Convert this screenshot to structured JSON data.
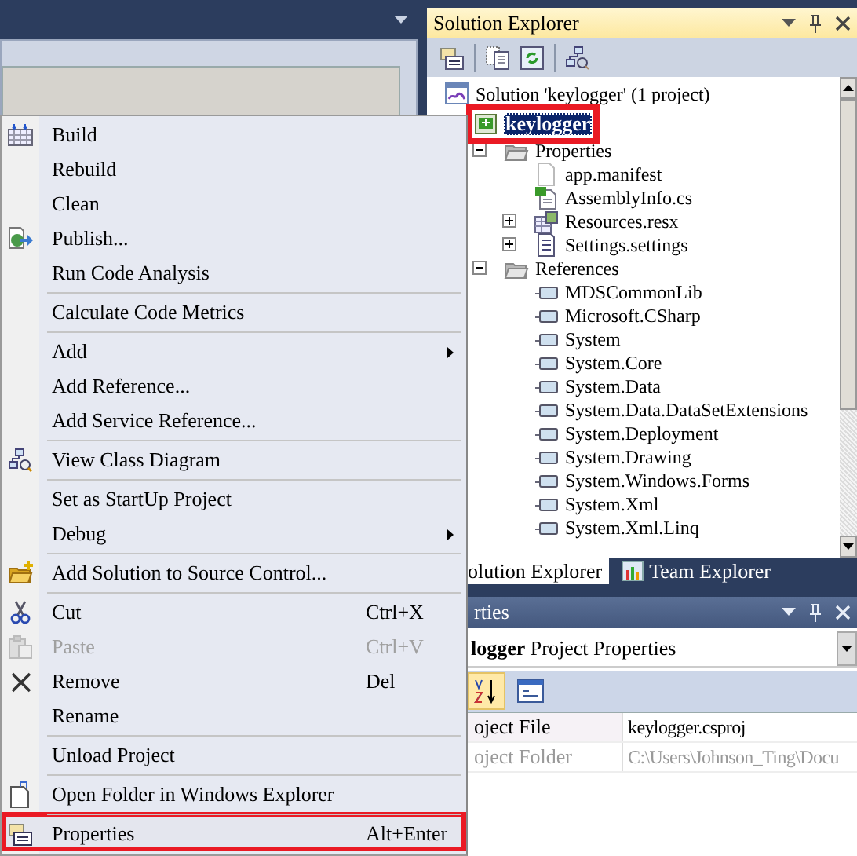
{
  "solution_explorer": {
    "title": "Solution Explorer",
    "tree": [
      {
        "label": "Solution 'keylogger' (1 project)",
        "kind": "solution",
        "selected": false,
        "annotated": false,
        "children": [
          {
            "label": "keylogger",
            "kind": "project",
            "selected": true,
            "annotated": true,
            "children": [
              {
                "label": "Properties",
                "kind": "folder",
                "expanded": true,
                "selected": false,
                "annotated": false,
                "children": [
                  {
                    "label": "app.manifest",
                    "kind": "file",
                    "selected": false,
                    "annotated": false
                  },
                  {
                    "label": "AssemblyInfo.cs",
                    "kind": "code",
                    "selected": false,
                    "annotated": false
                  },
                  {
                    "label": "Resources.resx",
                    "kind": "resources",
                    "expanded": false,
                    "selected": false,
                    "annotated": false
                  },
                  {
                    "label": "Settings.settings",
                    "kind": "settings",
                    "expanded": false,
                    "selected": false,
                    "annotated": false
                  }
                ]
              },
              {
                "label": "References",
                "kind": "folder",
                "expanded": true,
                "selected": false,
                "annotated": false,
                "children": [
                  {
                    "label": "MDSCommonLib",
                    "kind": "reference",
                    "selected": false,
                    "annotated": false
                  },
                  {
                    "label": "Microsoft.CSharp",
                    "kind": "reference",
                    "selected": false,
                    "annotated": false
                  },
                  {
                    "label": "System",
                    "kind": "reference",
                    "selected": false,
                    "annotated": false
                  },
                  {
                    "label": "System.Core",
                    "kind": "reference",
                    "selected": false,
                    "annotated": false
                  },
                  {
                    "label": "System.Data",
                    "kind": "reference",
                    "selected": false,
                    "annotated": false
                  },
                  {
                    "label": "System.Data.DataSetExtensions",
                    "kind": "reference",
                    "selected": false,
                    "annotated": false
                  },
                  {
                    "label": "System.Deployment",
                    "kind": "reference",
                    "selected": false,
                    "annotated": false
                  },
                  {
                    "label": "System.Drawing",
                    "kind": "reference",
                    "selected": false,
                    "annotated": false
                  },
                  {
                    "label": "System.Windows.Forms",
                    "kind": "reference",
                    "selected": false,
                    "annotated": false
                  },
                  {
                    "label": "System.Xml",
                    "kind": "reference",
                    "selected": false,
                    "annotated": false
                  },
                  {
                    "label": "System.Xml.Linq",
                    "kind": "reference",
                    "selected": false,
                    "annotated": false
                  }
                ]
              }
            ]
          }
        ]
      }
    ]
  },
  "bottom_tabs": [
    {
      "label": "olution Explorer",
      "selected": true
    },
    {
      "label": "Team Explorer",
      "selected": false
    }
  ],
  "properties": {
    "title": "rties",
    "object": "**logger** Project Properties",
    "toolbar": [
      {
        "kind": "alphabetical",
        "selected": true
      },
      {
        "kind": "property-pages",
        "selected": false
      }
    ],
    "rows": [
      {
        "name": "oject File",
        "value": "keylogger.csproj",
        "disabled": false
      },
      {
        "name": "oject Folder",
        "value": "C:\\Users\\Johnson_Ting\\Docu",
        "disabled": true
      }
    ]
  },
  "context_menu": {
    "items": [
      {
        "label": "Build",
        "kind": "build",
        "separator_before": false,
        "submenu": false,
        "disabled": false,
        "annotated": false
      },
      {
        "label": "Rebuild",
        "separator_before": false,
        "submenu": false,
        "disabled": false,
        "annotated": false
      },
      {
        "label": "Clean",
        "separator_before": false,
        "submenu": false,
        "disabled": false,
        "annotated": false
      },
      {
        "label": "Publish...",
        "kind": "publish",
        "separator_before": false,
        "submenu": false,
        "disabled": false,
        "annotated": false
      },
      {
        "label": "Run Code Analysis",
        "separator_before": false,
        "submenu": false,
        "disabled": false,
        "annotated": false
      },
      {
        "label": "Calculate Code Metrics",
        "separator_before": true,
        "submenu": false,
        "disabled": false,
        "annotated": false
      },
      {
        "label": "Add",
        "separator_before": true,
        "submenu": true,
        "disabled": false,
        "annotated": false
      },
      {
        "label": "Add Reference...",
        "separator_before": false,
        "submenu": false,
        "disabled": false,
        "annotated": false
      },
      {
        "label": "Add Service Reference...",
        "separator_before": false,
        "submenu": false,
        "disabled": false,
        "annotated": false
      },
      {
        "label": "View Class Diagram",
        "kind": "diagram",
        "separator_before": true,
        "submenu": false,
        "disabled": false,
        "annotated": false
      },
      {
        "label": "Set as StartUp Project",
        "separator_before": true,
        "submenu": false,
        "disabled": false,
        "annotated": false
      },
      {
        "label": "Debug",
        "separator_before": false,
        "submenu": true,
        "disabled": false,
        "annotated": false
      },
      {
        "label": "Add Solution to Source Control...",
        "kind": "source-control",
        "separator_before": true,
        "submenu": false,
        "disabled": false,
        "annotated": false
      },
      {
        "label": "Cut",
        "shortcut": "Ctrl+X",
        "kind": "cut",
        "separator_before": true,
        "submenu": false,
        "disabled": false,
        "annotated": false
      },
      {
        "label": "Paste",
        "shortcut": "Ctrl+V",
        "kind": "paste",
        "separator_before": false,
        "submenu": false,
        "disabled": true,
        "annotated": false
      },
      {
        "label": "Remove",
        "shortcut": "Del",
        "kind": "remove",
        "separator_before": false,
        "submenu": false,
        "disabled": false,
        "annotated": false
      },
      {
        "label": "Rename",
        "separator_before": false,
        "submenu": false,
        "disabled": false,
        "annotated": false
      },
      {
        "label": "Unload Project",
        "separator_before": true,
        "submenu": false,
        "disabled": false,
        "annotated": false
      },
      {
        "label": "Open Folder in Windows Explorer",
        "kind": "open-folder",
        "separator_before": true,
        "submenu": false,
        "disabled": false,
        "annotated": false
      },
      {
        "label": "Properties",
        "shortcut": "Alt+Enter",
        "kind": "properties",
        "separator_before": true,
        "submenu": false,
        "disabled": false,
        "annotated": true
      }
    ]
  }
}
